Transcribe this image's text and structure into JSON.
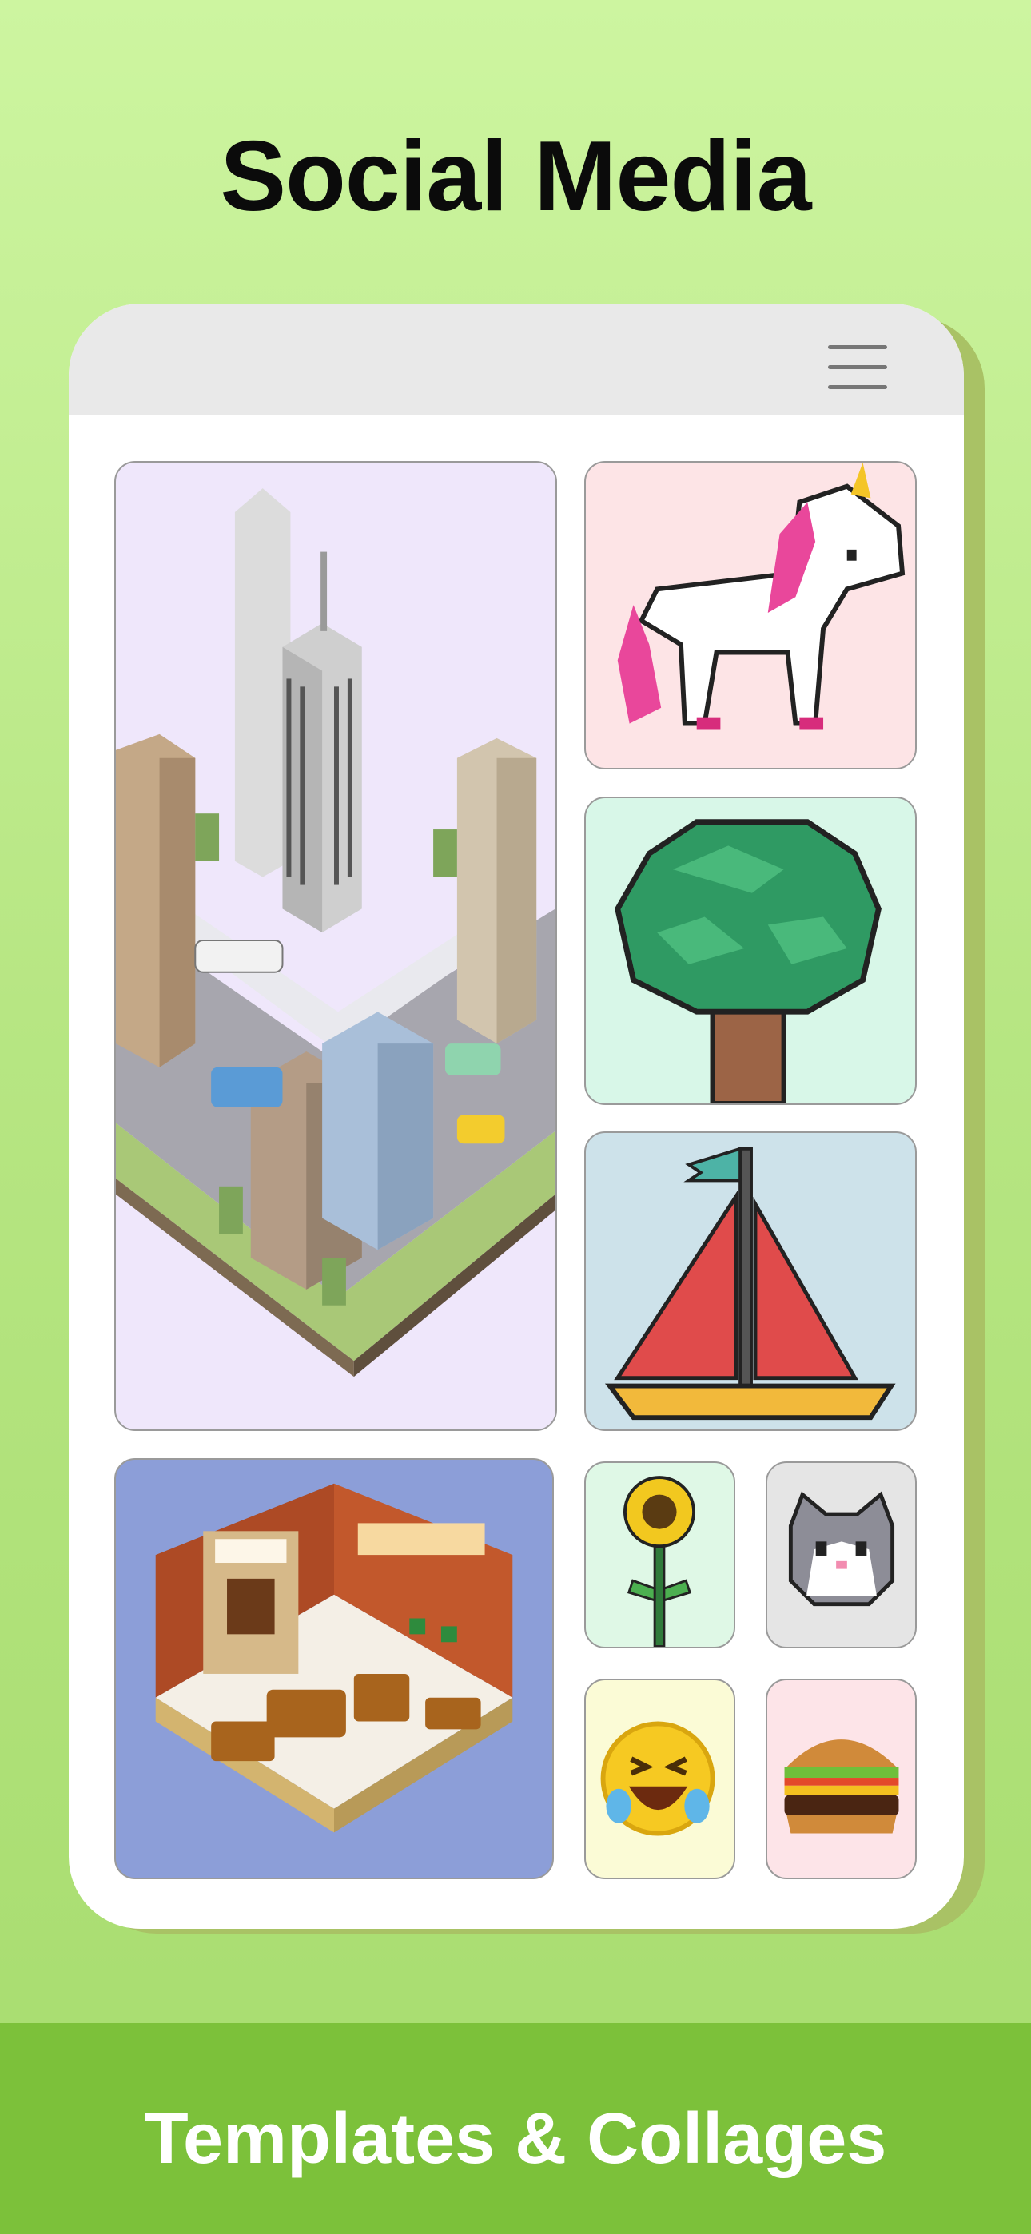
{
  "header": {
    "title": "Social Media"
  },
  "phone": {
    "menu_icon": "hamburger-menu-icon"
  },
  "gallery": [
    {
      "subject": "isometric city block",
      "background": "#efe7fb"
    },
    {
      "subject": "pixel unicorn",
      "background": "#fde4e6"
    },
    {
      "subject": "pixel tree",
      "background": "#d8f7e8"
    },
    {
      "subject": "pixel sailboat",
      "background": "#cde2ea"
    },
    {
      "subject": "isometric living room",
      "background": "#8c9ed8"
    },
    {
      "subject": "pixel sunflower",
      "background": "#dff8e6"
    },
    {
      "subject": "pixel cat face",
      "background": "#e5e5e5"
    },
    {
      "subject": "voxel laughing emoji",
      "background": "#fbfbd6"
    },
    {
      "subject": "voxel burger",
      "background": "#fde4e8"
    }
  ],
  "footer": {
    "title": "Templates & Collages"
  },
  "colors": {
    "accent_green": "#7cc13a",
    "background_top": "#cdf5a0"
  }
}
